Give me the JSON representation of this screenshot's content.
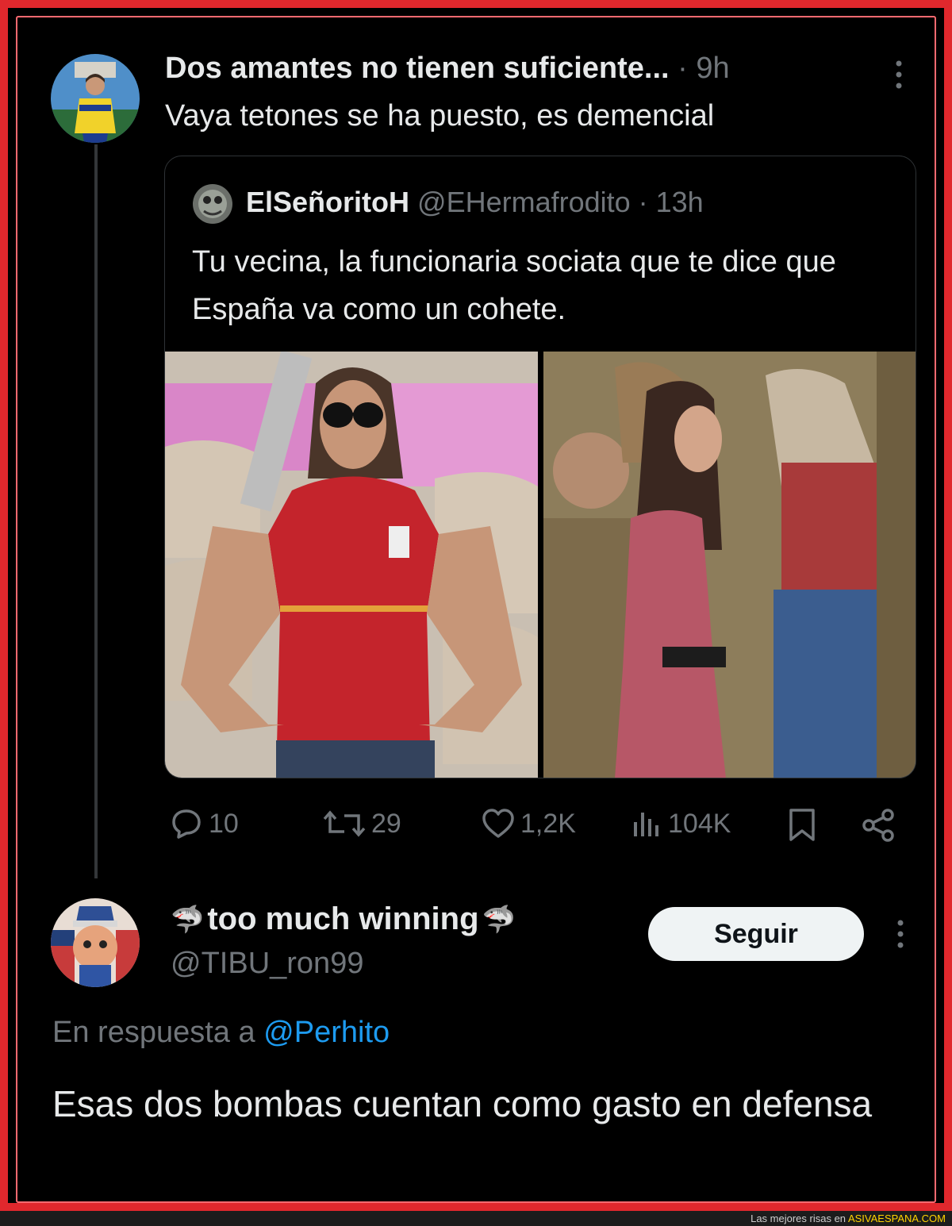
{
  "tweet1": {
    "display_name": "Dos amantes no tienen suficiente...",
    "time": " · 9h",
    "text": "Vaya tetones se ha puesto, es demencial"
  },
  "quote": {
    "display_name": "ElSeñoritoH",
    "handle": " @EHermafrodito · 13h",
    "text": "Tu vecina, la funcionaria sociata que te dice que España va como un cohete.",
    "stats": {
      "replies": "10",
      "retweets": "29",
      "likes": "1,2K",
      "views": "104K"
    }
  },
  "tweet2": {
    "display_name": "too much winning",
    "emoji": "🦈",
    "handle": "@TIBU_ron99",
    "follow_label": "Seguir",
    "reply_prefix": "En respuesta a ",
    "reply_mention": "@Perhito",
    "text": "Esas dos bombas cuentan como gasto en defensa"
  },
  "footer": {
    "prefix": "Las mejores risas en ",
    "site": "ASIVAESPANA.COM"
  },
  "colors": {
    "frame": "#e0282d",
    "background": "#000000",
    "text": "#e7e9ea",
    "muted": "#71767b",
    "link": "#1d9bf0"
  },
  "icons": [
    "more-icon",
    "reply-icon",
    "retweet-icon",
    "like-icon",
    "views-icon",
    "bookmark-icon",
    "share-icon",
    "shark-icon"
  ]
}
